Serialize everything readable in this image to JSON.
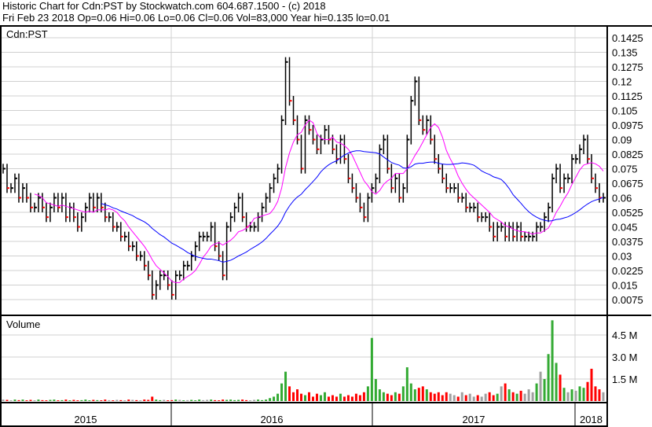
{
  "header": {
    "title": "Historic Chart for Cdn:PST by Stockwatch.com 604.687.1500 - (c) 2018",
    "quote": "Fri Feb 23 2018  Op=0.06  Hi=0.06  Lo=0.06  Cl=0.06  Vol=83,000  Year hi=0.135  lo=0.01"
  },
  "colors": {
    "up": "#33aa33",
    "down": "#ff0000",
    "flat": "#a0a0a0",
    "ma_short": "#ff00ff",
    "ma_long": "#0000ff",
    "bar": "#000000"
  },
  "chart_data": {
    "type": "line",
    "title": "Cdn:PST",
    "price_panel_label": "Cdn:PST",
    "volume_panel_label": "Volume",
    "price_ticks": [
      "0.1425",
      "0.135",
      "0.1275",
      "0.12",
      "0.1125",
      "0.105",
      "0.0975",
      "0.09",
      "0.0825",
      "0.075",
      "0.0675",
      "0.06",
      "0.0525",
      "0.045",
      "0.0375",
      "0.03",
      "0.0225",
      "0.015",
      "0.0075"
    ],
    "price_range": [
      0.0,
      0.1425
    ],
    "volume_ticks": [
      "4.5 M",
      "3.0 M",
      "1.5 M"
    ],
    "volume_range_millions": [
      0,
      5.5
    ],
    "year_labels": [
      "2015",
      "2016",
      "2017",
      "2018"
    ],
    "x_start_year": 2015,
    "weekly_close": [
      0.075,
      0.065,
      0.065,
      0.07,
      0.06,
      0.065,
      0.06,
      0.055,
      0.055,
      0.06,
      0.055,
      0.05,
      0.055,
      0.06,
      0.055,
      0.06,
      0.05,
      0.055,
      0.05,
      0.045,
      0.05,
      0.055,
      0.06,
      0.055,
      0.06,
      0.055,
      0.05,
      0.05,
      0.045,
      0.045,
      0.04,
      0.04,
      0.035,
      0.035,
      0.03,
      0.03,
      0.025,
      0.02,
      0.01,
      0.015,
      0.02,
      0.02,
      0.015,
      0.01,
      0.02,
      0.02,
      0.025,
      0.025,
      0.03,
      0.035,
      0.04,
      0.04,
      0.04,
      0.045,
      0.035,
      0.03,
      0.02,
      0.045,
      0.05,
      0.055,
      0.06,
      0.05,
      0.045,
      0.045,
      0.045,
      0.05,
      0.055,
      0.06,
      0.065,
      0.07,
      0.075,
      0.1,
      0.13,
      0.11,
      0.1,
      0.09,
      0.075,
      0.1,
      0.095,
      0.09,
      0.085,
      0.09,
      0.095,
      0.09,
      0.085,
      0.08,
      0.09,
      0.08,
      0.07,
      0.065,
      0.06,
      0.055,
      0.05,
      0.06,
      0.065,
      0.07,
      0.085,
      0.09,
      0.075,
      0.065,
      0.07,
      0.06,
      0.065,
      0.09,
      0.11,
      0.12,
      0.1,
      0.095,
      0.1,
      0.09,
      0.08,
      0.075,
      0.07,
      0.065,
      0.065,
      0.065,
      0.06,
      0.06,
      0.055,
      0.055,
      0.055,
      0.05,
      0.05,
      0.05,
      0.045,
      0.04,
      0.045,
      0.045,
      0.04,
      0.045,
      0.04,
      0.045,
      0.04,
      0.04,
      0.04,
      0.04,
      0.045,
      0.045,
      0.05,
      0.055,
      0.07,
      0.075,
      0.065,
      0.07,
      0.07,
      0.08,
      0.08,
      0.085,
      0.09,
      0.08,
      0.07,
      0.065,
      0.06,
      0.06
    ],
    "weekly_volume_millions": [
      0.1,
      0.08,
      0.05,
      0.1,
      0.06,
      0.1,
      0.05,
      0.08,
      0.05,
      0.1,
      0.06,
      0.05,
      0.08,
      0.1,
      0.05,
      0.06,
      0.1,
      0.05,
      0.08,
      0.05,
      0.06,
      0.1,
      0.05,
      0.08,
      0.06,
      0.05,
      0.1,
      0.06,
      0.05,
      0.08,
      0.06,
      0.05,
      0.1,
      0.08,
      0.06,
      0.05,
      0.1,
      0.08,
      0.3,
      0.1,
      0.06,
      0.08,
      0.05,
      0.06,
      0.1,
      0.08,
      0.05,
      0.06,
      0.08,
      0.05,
      0.1,
      0.06,
      0.08,
      0.1,
      0.06,
      0.05,
      0.1,
      0.08,
      0.1,
      0.06,
      0.08,
      0.1,
      0.06,
      0.05,
      0.08,
      0.1,
      0.06,
      0.1,
      0.2,
      0.3,
      0.5,
      1.2,
      2.0,
      1.0,
      0.6,
      0.8,
      0.5,
      0.4,
      0.6,
      0.3,
      0.5,
      0.4,
      0.6,
      0.3,
      0.4,
      0.3,
      0.5,
      0.3,
      0.4,
      0.3,
      0.5,
      0.4,
      0.6,
      1.0,
      4.3,
      1.5,
      0.8,
      0.6,
      0.5,
      0.4,
      0.6,
      0.5,
      1.0,
      2.3,
      1.2,
      0.8,
      0.9,
      1.0,
      0.8,
      0.6,
      0.5,
      0.6,
      0.4,
      0.6,
      0.5,
      0.4,
      0.3,
      0.6,
      0.4,
      0.5,
      0.3,
      0.4,
      0.3,
      0.5,
      0.6,
      0.4,
      0.5,
      1.0,
      1.2,
      0.8,
      0.6,
      0.5,
      0.7,
      0.5,
      0.8,
      0.6,
      1.2,
      2.0,
      1.5,
      3.2,
      5.5,
      2.6,
      1.8,
      0.9,
      0.6,
      0.8,
      0.7,
      1.0,
      0.9,
      1.3,
      2.2,
      1.0,
      0.8,
      0.6,
      0.4,
      0.3
    ]
  }
}
